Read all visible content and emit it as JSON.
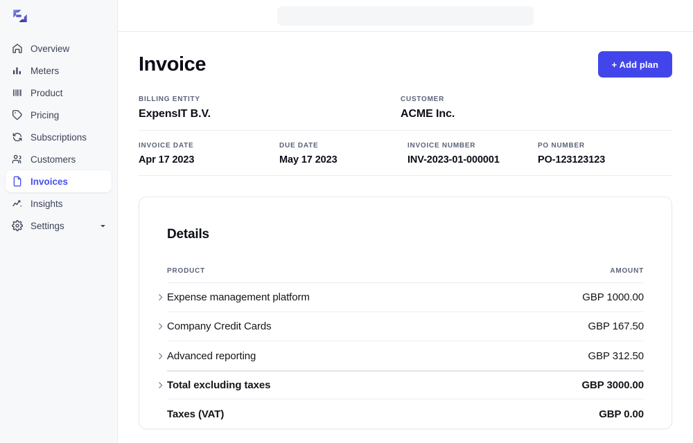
{
  "brand": {
    "logo_icon": "expensit-logo-mark",
    "accent_color": "#4246ea",
    "logo_gradient_from": "#7b7ff0",
    "logo_gradient_to": "#2f2f9e"
  },
  "sidebar": {
    "items": [
      {
        "label": "Overview",
        "icon": "home-icon",
        "active": false,
        "caret": false
      },
      {
        "label": "Meters",
        "icon": "bar-chart-icon",
        "active": false,
        "caret": false
      },
      {
        "label": "Product",
        "icon": "barcode-icon",
        "active": false,
        "caret": false
      },
      {
        "label": "Pricing",
        "icon": "tag-icon",
        "active": false,
        "caret": false
      },
      {
        "label": "Subscriptions",
        "icon": "refresh-icon",
        "active": false,
        "caret": false
      },
      {
        "label": "Customers",
        "icon": "users-icon",
        "active": false,
        "caret": false
      },
      {
        "label": "Invoices",
        "icon": "document-icon",
        "active": true,
        "caret": false
      },
      {
        "label": "Insights",
        "icon": "trending-up-icon",
        "active": false,
        "caret": false
      },
      {
        "label": "Settings",
        "icon": "gear-icon",
        "active": false,
        "caret": true
      }
    ]
  },
  "topbar": {
    "search_placeholder": "",
    "search_value": "",
    "search_icon": "search-icon"
  },
  "page": {
    "title": "Invoice",
    "add_plan_label": "+ Add plan"
  },
  "meta": {
    "billing_entity_label": "BILLING ENTITY",
    "billing_entity_value": "ExpensIT B.V.",
    "customer_label": "CUSTOMER",
    "customer_value": "ACME Inc.",
    "invoice_date_label": "INVOICE DATE",
    "invoice_date_value": "Apr 17 2023",
    "due_date_label": "DUE DATE",
    "due_date_value": "May 17 2023",
    "invoice_number_label": "INVOICE NUMBER",
    "invoice_number_value": "INV-2023-01-000001",
    "po_number_label": "PO NUMBER",
    "po_number_value": "PO-123123123"
  },
  "details": {
    "title": "Details",
    "columns": {
      "product": "PRODUCT",
      "amount": "AMOUNT"
    },
    "rows": [
      {
        "name": "Expense management platform",
        "amount": "GBP 1000.00",
        "expandable": true,
        "emphasis": false
      },
      {
        "name": "Company Credit Cards",
        "amount": "GBP 167.50",
        "expandable": true,
        "emphasis": false
      },
      {
        "name": "Advanced reporting",
        "amount": "GBP 312.50",
        "expandable": true,
        "emphasis": false
      },
      {
        "name": "Total excluding taxes",
        "amount": "GBP 3000.00",
        "expandable": true,
        "emphasis": true
      },
      {
        "name": "Taxes (VAT)",
        "amount": "GBP 0.00",
        "expandable": false,
        "emphasis": true
      }
    ]
  }
}
